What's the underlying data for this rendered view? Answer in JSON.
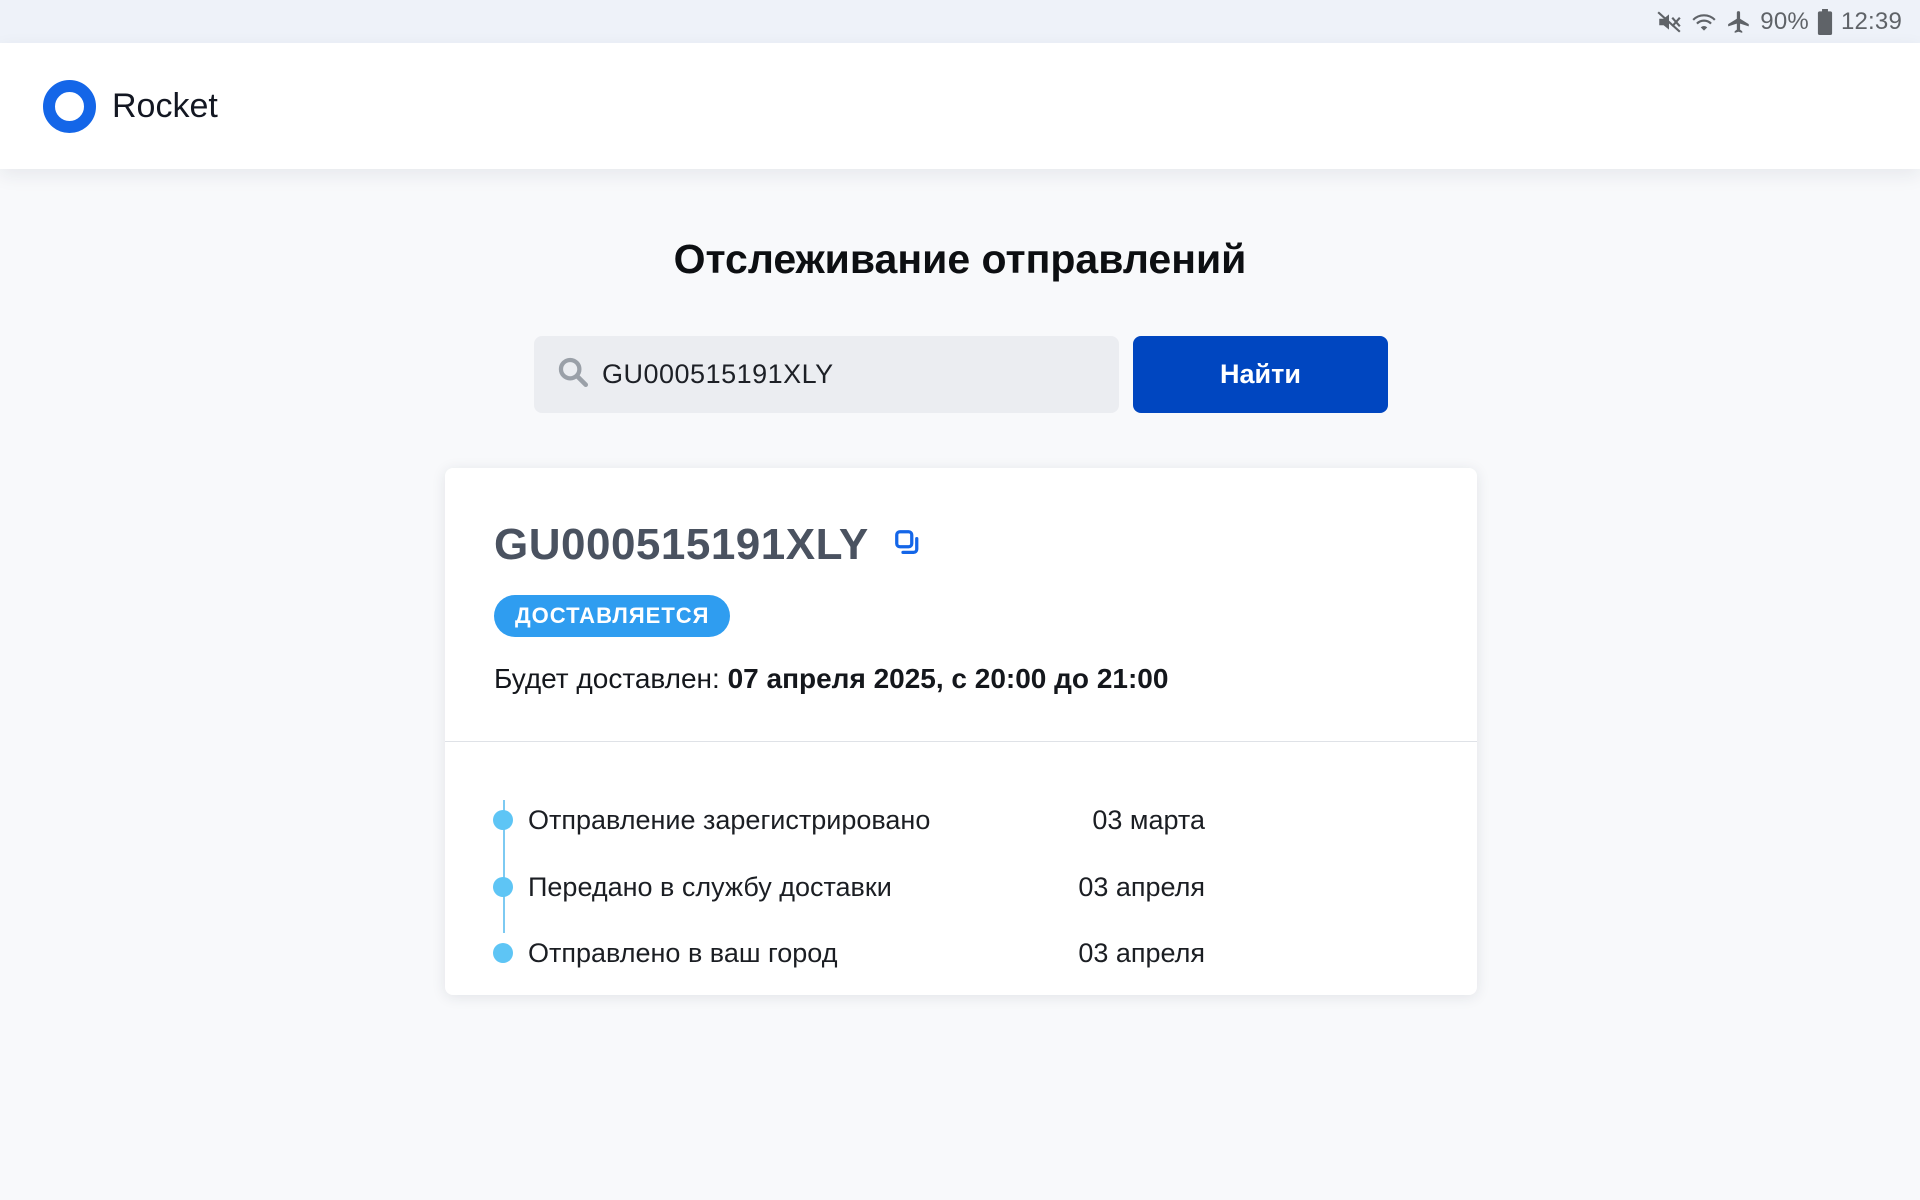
{
  "status_bar": {
    "battery": "90%",
    "time": "12:39",
    "icons": [
      "mute-icon",
      "wifi-icon",
      "airplane-icon",
      "battery-icon"
    ]
  },
  "header": {
    "brand": "Rocket",
    "logo_color": "#1466e8"
  },
  "main": {
    "title": "Отслеживание отправлений",
    "search": {
      "value": "GU000515191XLY",
      "button_label": "Найти",
      "button_color": "#0046c0"
    },
    "result": {
      "tracking_number": "GU000515191XLY",
      "status_badge": "ДОСТАВЛЯЕТСЯ",
      "status_color": "#2f9df0",
      "delivery_label": "Будет доставлен:",
      "delivery_date": "07 апреля 2025, с 20:00 до 21:00",
      "events": [
        {
          "label": "Отправление зарегистрировано",
          "date": "03 марта"
        },
        {
          "label": "Передано в службу доставки",
          "date": "03 апреля"
        },
        {
          "label": "Отправлено в ваш город",
          "date": "03 апреля"
        }
      ]
    }
  }
}
